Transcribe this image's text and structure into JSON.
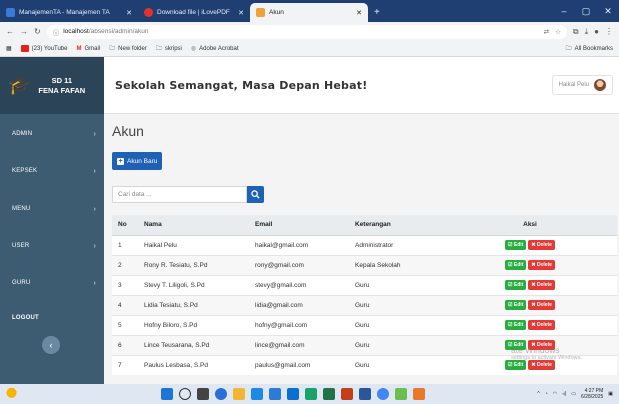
{
  "browser": {
    "tabs": [
      {
        "title": "ManajemenTA - Manajemen TA"
      },
      {
        "title": "Download file | iLovePDF"
      },
      {
        "title": "Akun"
      }
    ],
    "url_host": "localhost",
    "url_path": "/absensi/admin/akun",
    "bookmarks": [
      "(23) YouTube",
      "Gmail",
      "New folder",
      "skripsi",
      "Adobe Acrobat"
    ],
    "all_bookmarks": "All Bookmarks"
  },
  "sidebar": {
    "brand_line1": "SD 11",
    "brand_line2": "FENA FAFAN",
    "items": [
      {
        "label": "ADMIN"
      },
      {
        "label": "KEPSEK"
      },
      {
        "label": "MENU"
      },
      {
        "label": "USER"
      },
      {
        "label": "GURU"
      },
      {
        "label": "LOGOUT"
      }
    ]
  },
  "header": {
    "tagline": "Sekolah Semangat, Masa Depan Hebat!",
    "user_name": "Haikal Pelu"
  },
  "main": {
    "title": "Akun",
    "add_button": "Akun Baru",
    "search_placeholder": "Cari data ...",
    "columns": [
      "No",
      "Nama",
      "Email",
      "Keterangan",
      "Aksi"
    ],
    "edit_label": "Edit",
    "delete_label": "Delete",
    "rows": [
      {
        "no": "1",
        "nama": "Haikal Pelu",
        "email": "haikal@gmail.com",
        "keterangan": "Administrator"
      },
      {
        "no": "2",
        "nama": "Rony R. Tesiatu, S.Pd",
        "email": "rony@gmail.com",
        "keterangan": "Kepala Sekolah"
      },
      {
        "no": "3",
        "nama": "Stevy T. Liligoli, S.Pd",
        "email": "stevy@gmail.com",
        "keterangan": "Guru"
      },
      {
        "no": "4",
        "nama": "Lidia Tesiatu, S.Pd",
        "email": "lidia@gmail.com",
        "keterangan": "Guru"
      },
      {
        "no": "5",
        "nama": "Hofny Biloro, S.Pd",
        "email": "hofny@gmail.com",
        "keterangan": "Guru"
      },
      {
        "no": "6",
        "nama": "Lince Teusarana, S.Pd",
        "email": "lince@gmail.com",
        "keterangan": "Guru"
      },
      {
        "no": "7",
        "nama": "Paulus Lesbasa, S.Pd",
        "email": "paulus@gmail.com",
        "keterangan": "Guru"
      }
    ]
  },
  "watermark": {
    "line1": "ate Windows",
    "line2": "settings to activate Windows."
  },
  "taskbar": {
    "time": "4:27 PM",
    "date": "6/28/2025"
  },
  "colors": {
    "sidebar": "#3d5c72",
    "brand_bg": "#2c4457",
    "primary": "#1f61b5",
    "edit": "#27ae3f",
    "delete": "#e53935"
  }
}
